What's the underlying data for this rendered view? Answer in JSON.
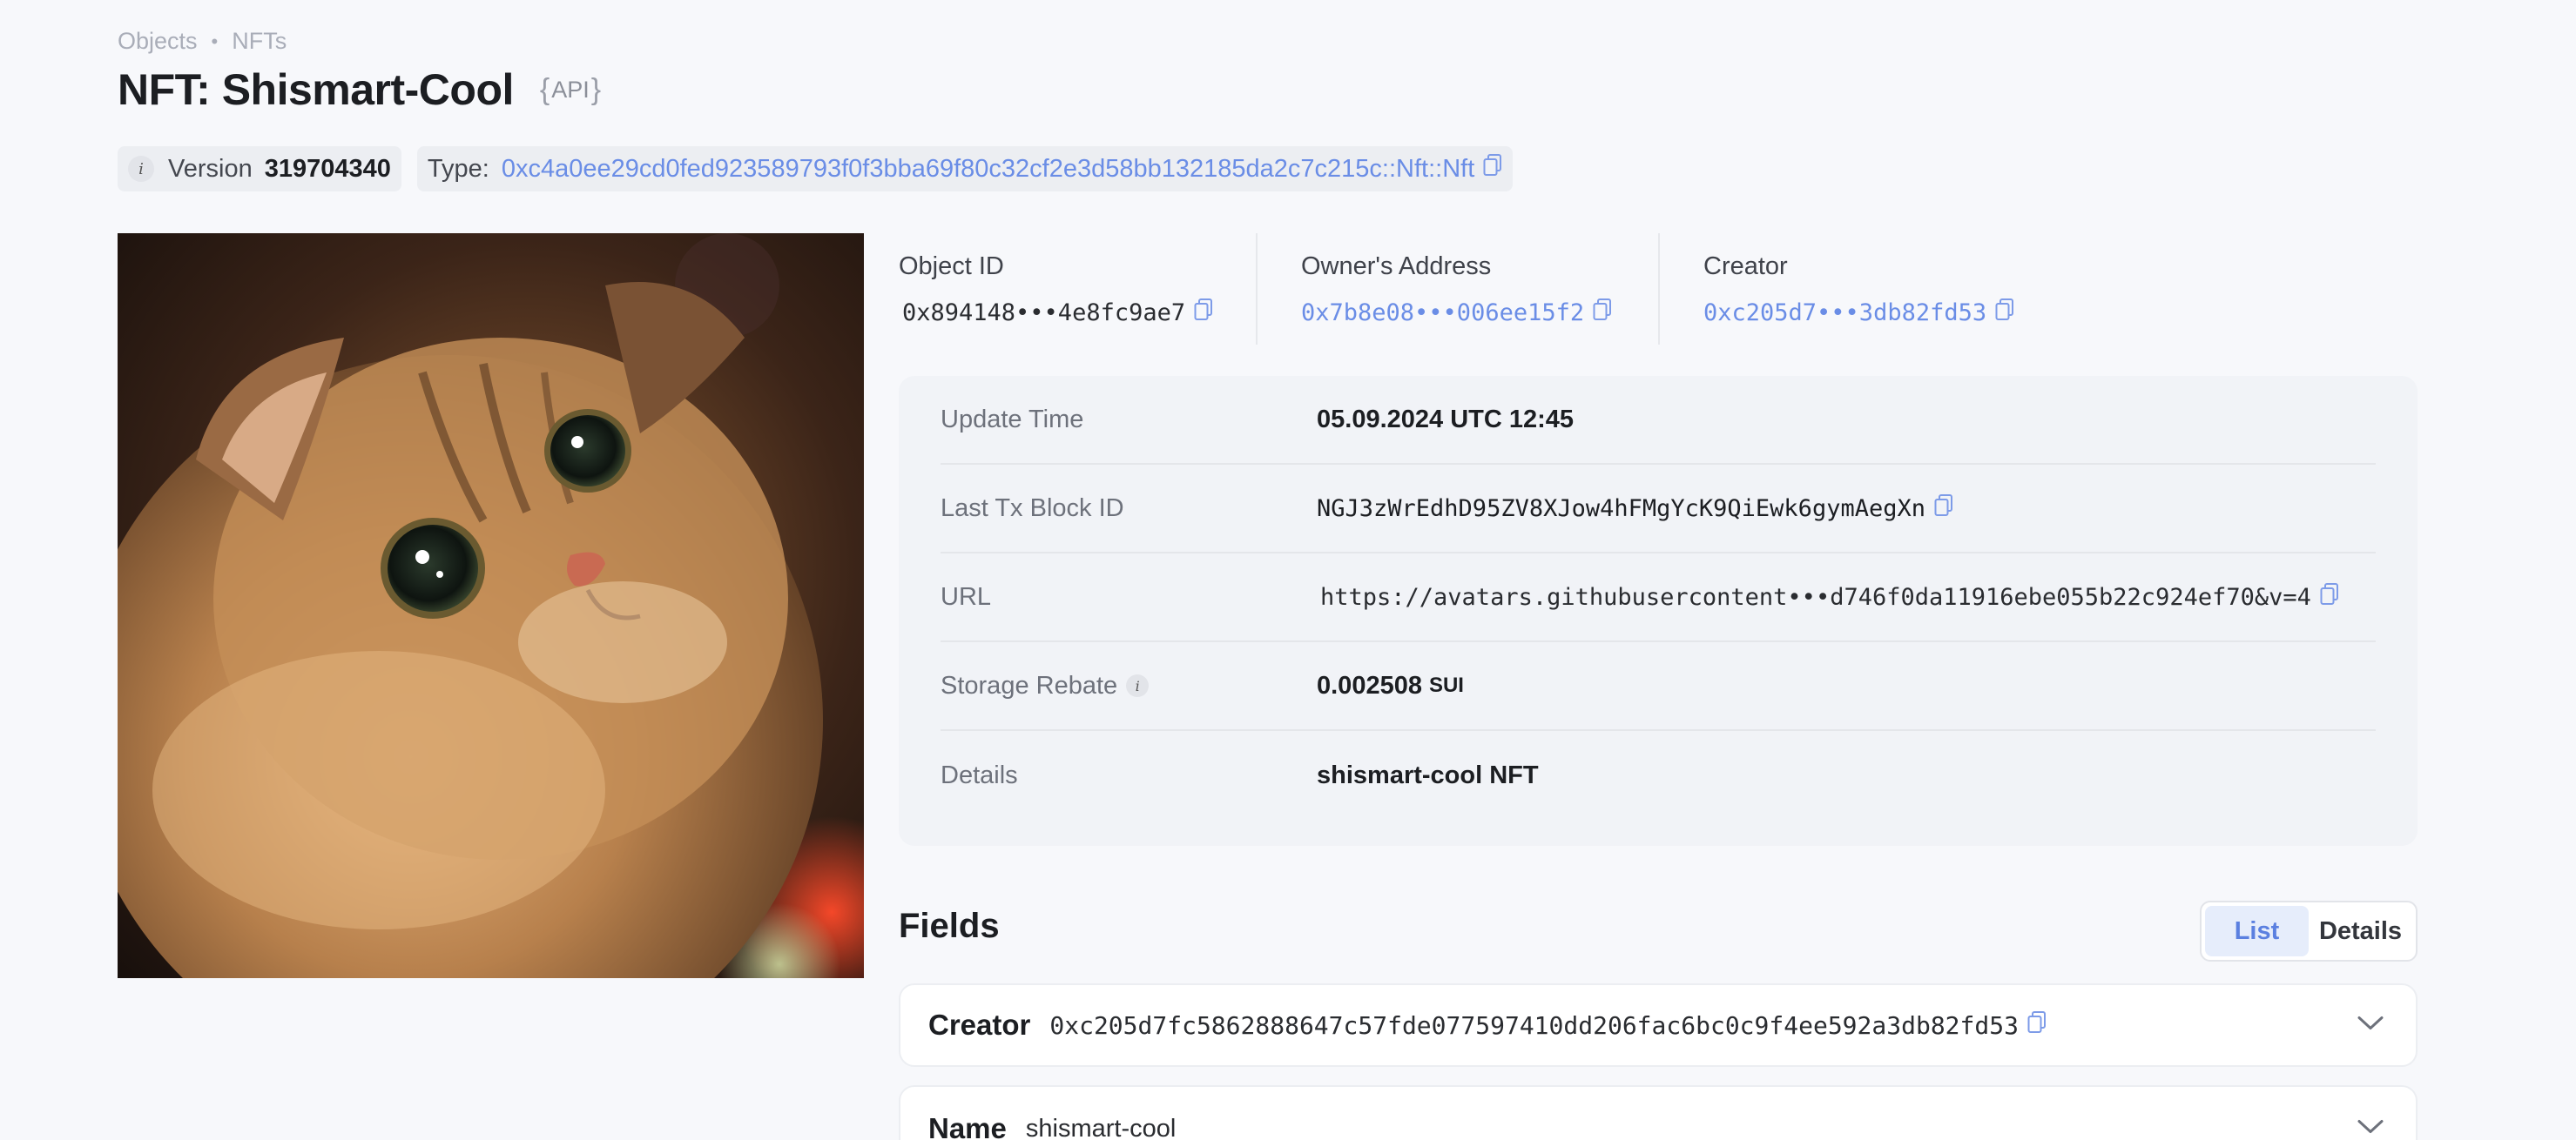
{
  "breadcrumb": {
    "items": [
      "Objects",
      "NFTs"
    ],
    "separator": "•"
  },
  "title": "NFT: Shismart-Cool",
  "api_badge": {
    "open": "{",
    "label": "API",
    "close": "}"
  },
  "chips": {
    "version_label": "Version",
    "version_value": "319704340",
    "type_label": "Type:",
    "type_value": "0xc4a0ee29cd0fed923589793f0f3bba69f80c32cf2e3d58bb132185da2c7c215c::Nft::Nft"
  },
  "info": {
    "object_id_label": "Object ID",
    "object_id_value": "0x894148•••4e8fc9ae7",
    "owner_label": "Owner's Address",
    "owner_value": "0x7b8e08•••006ee15f2",
    "creator_label": "Creator",
    "creator_value": "0xc205d7•••3db82fd53"
  },
  "details": {
    "update_time_label": "Update Time",
    "update_time_value": "05.09.2024 UTC 12:45",
    "last_tx_label": "Last Tx Block ID",
    "last_tx_value": "NGJ3zWrEdhD95ZV8XJow4hFMgYcK9QiEwk6gymAegXn",
    "url_label": "URL",
    "url_value": "https://avatars.githubusercontent•••d746f0da11916ebe055b22c924ef70&v=4",
    "storage_rebate_label": "Storage Rebate",
    "storage_rebate_value": "0.002508",
    "storage_rebate_unit": "SUI",
    "details_label": "Details",
    "details_value": "shismart-cool NFT"
  },
  "fields": {
    "title": "Fields",
    "view_toggle": {
      "list_label": "List",
      "details_label": "Details",
      "active": "List"
    },
    "items": [
      {
        "name": "Creator",
        "value": "0xc205d7fc5862888647c57fde077597410dd206fac6bc0c9f4ee592a3db82fd53"
      },
      {
        "name": "Name",
        "value": "shismart-cool"
      }
    ]
  },
  "colors": {
    "link": "#6a8de6",
    "background": "#f7f8fb",
    "card": "#f1f3f7",
    "toggle_active": "#e6edfb"
  },
  "icons": [
    "info-icon",
    "copy-icon",
    "chevron-down-icon"
  ]
}
